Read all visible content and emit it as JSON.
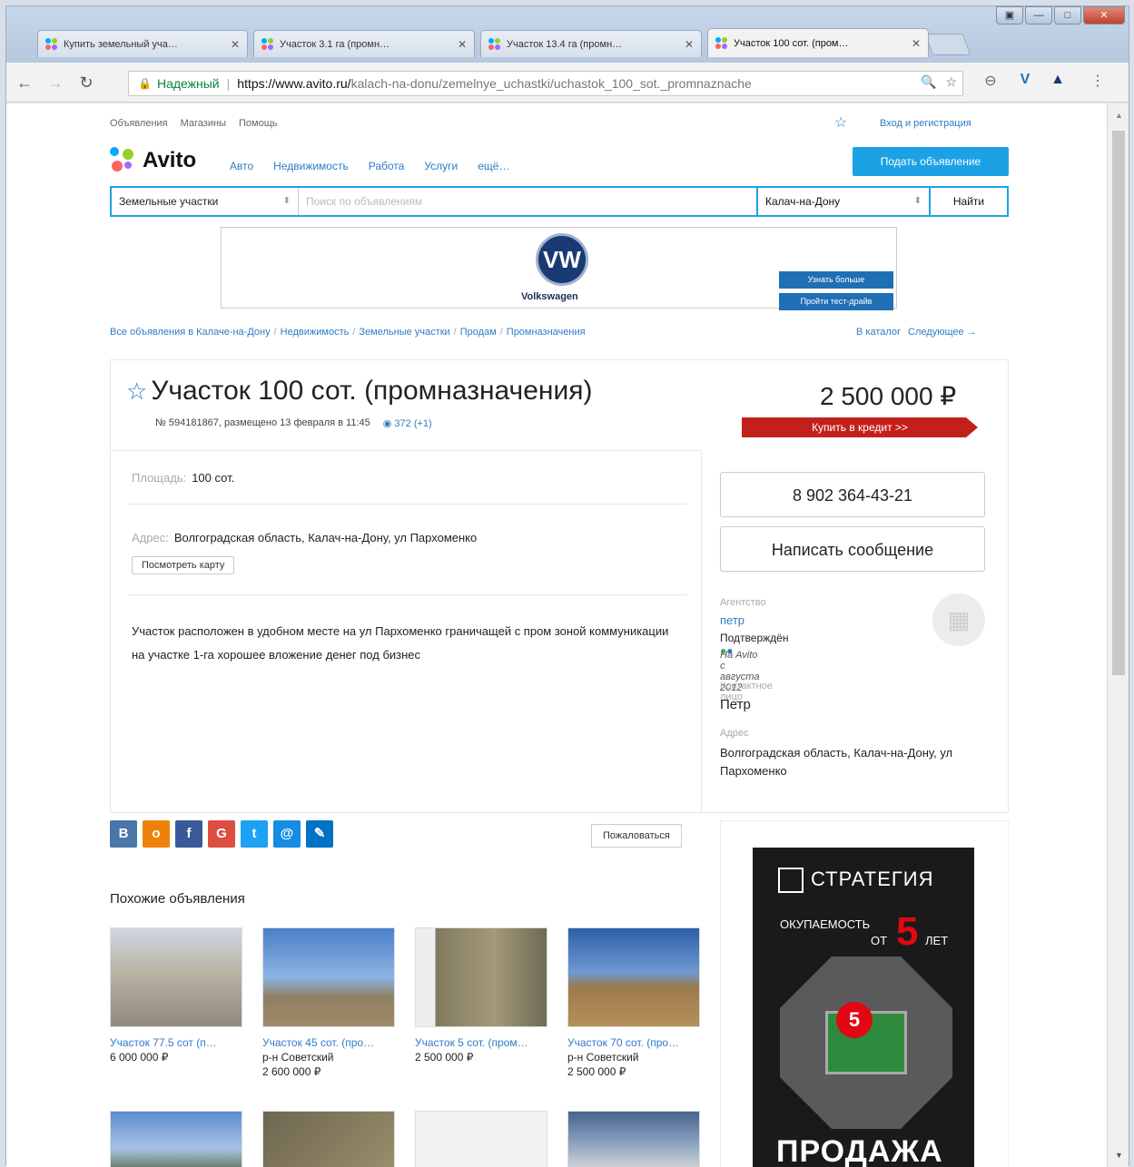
{
  "browser": {
    "tabs": [
      {
        "title": "Купить земельный уча…"
      },
      {
        "title": "Участок 3.1 га (промн…"
      },
      {
        "title": "Участок 13.4 га (промн…"
      },
      {
        "title": "Участок 100 сот. (пром…"
      }
    ],
    "secure_label": "Надежный",
    "url_host": "https://www.avito.ru/",
    "url_path": "kalach-na-donu/zemelnye_uchastki/uchastok_100_sot._promnaznache"
  },
  "header": {
    "topnav": [
      "Объявления",
      "Магазины",
      "Помощь"
    ],
    "login": "Вход и регистрация",
    "logo": "Avito",
    "catnav": [
      "Авто",
      "Недвижимость",
      "Работа",
      "Услуги",
      "ещё…"
    ],
    "post_button": "Подать объявление",
    "search": {
      "category": "Земельные участки",
      "placeholder": "Поиск по объявлениям",
      "city": "Калач-на-Дону",
      "button": "Найти"
    }
  },
  "banner": {
    "brand": "Volkswagen",
    "btn1": "Узнать больше",
    "btn2": "Пройти тест-драйв"
  },
  "breadcrumbs": [
    "Все объявления в Калаче-на-Дону",
    "Недвижимость",
    "Земельные участки",
    "Продам",
    "Промназначения"
  ],
  "nav": {
    "catalog": "В каталог",
    "next": "Следующее →"
  },
  "item": {
    "title": "Участок 100 сот. (промназначения)",
    "meta": "№ 594181867, размещено 13 февраля в 11:45",
    "views": "372 (+1)",
    "price": "2 500 000 ₽",
    "credit": "Купить в кредит >>",
    "area_label": "Площадь:",
    "area": "100 сот.",
    "address_label": "Адрес:",
    "address": "Волгоградская область, Калач-на-Дону, ул Пархоменко",
    "map_button": "Посмотреть карту",
    "description": "Участок расположен в удобном месте на ул Пархоменко граничащей с пром зоной коммуникации на участке 1-га хорошее вложение денег под бизнес"
  },
  "seller": {
    "phone": "8 902 364-43-21",
    "message_button": "Написать сообщение",
    "agency_label": "Агентство",
    "agency": "петр",
    "confirmed": "Подтверждён",
    "since": "На Avito с августа 2012",
    "contact_label": "Контактное лицо",
    "contact": "Петр",
    "address_label": "Адрес",
    "address": "Волгоградская область, Калач-на-Дону, ул Пархоменко"
  },
  "share": {
    "complain": "Пожаловаться"
  },
  "similar": {
    "heading": "Похожие объявления",
    "items": [
      {
        "title": "Участок 77.5 сот (п…",
        "loc": "",
        "price": "6 000 000 ₽"
      },
      {
        "title": "Участок 45 сот. (про…",
        "loc": "р-н Советский",
        "price": "2 600 000 ₽"
      },
      {
        "title": "Участок 5 сот. (пром…",
        "loc": "",
        "price": "2 500 000 ₽"
      },
      {
        "title": "Участок 70 сот. (про…",
        "loc": "р-н Советский",
        "price": "2 500 000 ₽"
      }
    ]
  },
  "ad": {
    "brand": "СТРАТЕГИЯ",
    "line1": "ОКУПАЕМОСТЬ",
    "line2": "ОТ",
    "years": "5",
    "line3": "ЛЕТ",
    "sale": "ПРОДАЖА"
  },
  "colors": {
    "accent": "#1da1e5",
    "link": "#2d7cc7",
    "credit": "#c4201b"
  }
}
